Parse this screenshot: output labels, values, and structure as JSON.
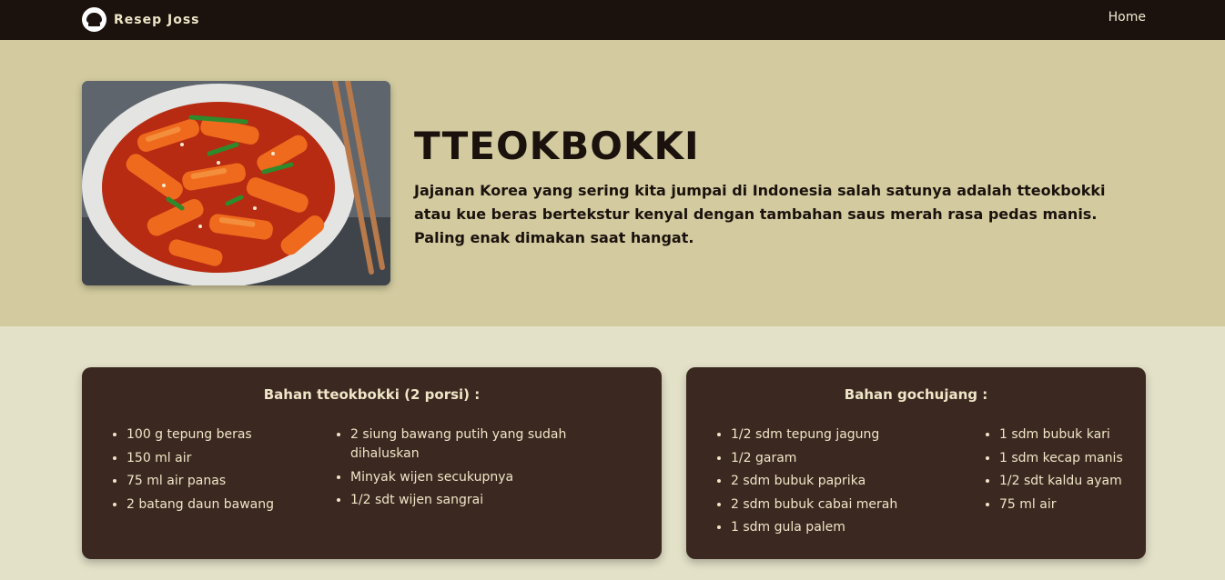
{
  "navbar": {
    "brand": "Resep Joss",
    "brand_logo_icon": "chef-hat-icon",
    "links": {
      "home": "Home"
    }
  },
  "hero": {
    "title": "TTEOKBOKKI",
    "description": "Jajanan Korea yang sering kita jumpai di Indonesia salah satunya adalah tteokbokki atau kue beras bertekstur kenyal dengan tambahan saus merah rasa pedas manis. Paling enak dimakan saat hangat."
  },
  "ingredients": [
    {
      "title": "Bahan tteokbokki (2 porsi) :",
      "columns": [
        [
          "100 g tepung beras",
          "150 ml air",
          "75 ml air panas",
          "2 batang daun bawang"
        ],
        [
          "2 siung bawang putih yang sudah dihaluskan",
          "Minyak wijen secukupnya",
          "1/2 sdt wijen sangrai"
        ]
      ]
    },
    {
      "title": "Bahan gochujang :",
      "columns": [
        [
          "1/2 sdm tepung jagung",
          "1/2 garam",
          "2 sdm bubuk paprika",
          "2 sdm bubuk cabai merah",
          "1 sdm gula palem"
        ],
        [
          "1 sdm bubuk kari",
          "1 sdm kecap manis",
          "1/2 sdt kaldu ayam",
          "75 ml air"
        ]
      ]
    }
  ],
  "colors": {
    "navbar": "#1b120e",
    "hero_background": "#d3cb9f",
    "page_background": "#e3e1c7",
    "card_background": "#3b2820",
    "card_text": "#efe6c8"
  }
}
